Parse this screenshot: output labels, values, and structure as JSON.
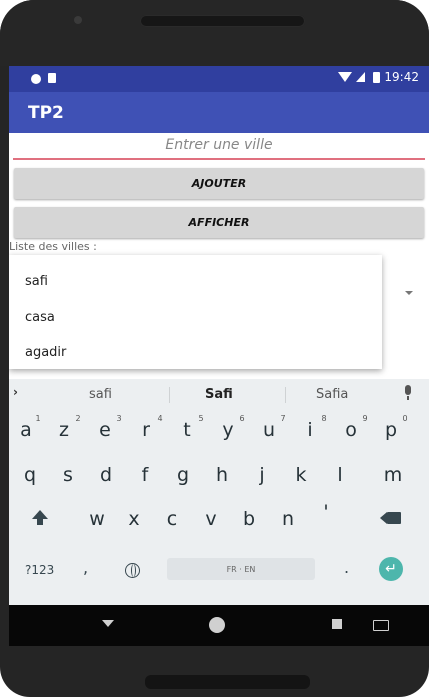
{
  "app": {
    "title": "TP2"
  },
  "status_bar": {
    "time": "19:42",
    "icons": [
      "dot-icon",
      "sd-card-icon",
      "wifi-icon",
      "signal-icon",
      "battery-icon"
    ]
  },
  "form": {
    "city_input": {
      "placeholder": "Entrer une ville",
      "value": ""
    },
    "add_button": "AJOUTER",
    "show_button": "AFFICHER",
    "list_label": "Liste des villes :"
  },
  "dropdown": {
    "items": [
      "safi",
      "casa",
      "agadir"
    ]
  },
  "keyboard": {
    "suggestions": [
      "safi",
      "Safi",
      "Safia"
    ],
    "row1": [
      "a",
      "z",
      "e",
      "r",
      "t",
      "y",
      "u",
      "i",
      "o",
      "p"
    ],
    "row1_hints": [
      "1",
      "2",
      "3",
      "4",
      "5",
      "6",
      "7",
      "8",
      "9",
      "0"
    ],
    "row2": [
      "q",
      "s",
      "d",
      "f",
      "g",
      "h",
      "j",
      "k",
      "l",
      "m"
    ],
    "row3": [
      "w",
      "x",
      "c",
      "v",
      "b",
      "n",
      "'"
    ],
    "symbols_key": "?123",
    "comma_key": ",",
    "period_key": ".",
    "space_label": "FR · EN",
    "enter_icon": "↵"
  },
  "colors": {
    "status_bar": "#303F9F",
    "app_bar": "#3F51B5",
    "input_underline": "#e0707f",
    "enter_key": "#4db6ac"
  }
}
